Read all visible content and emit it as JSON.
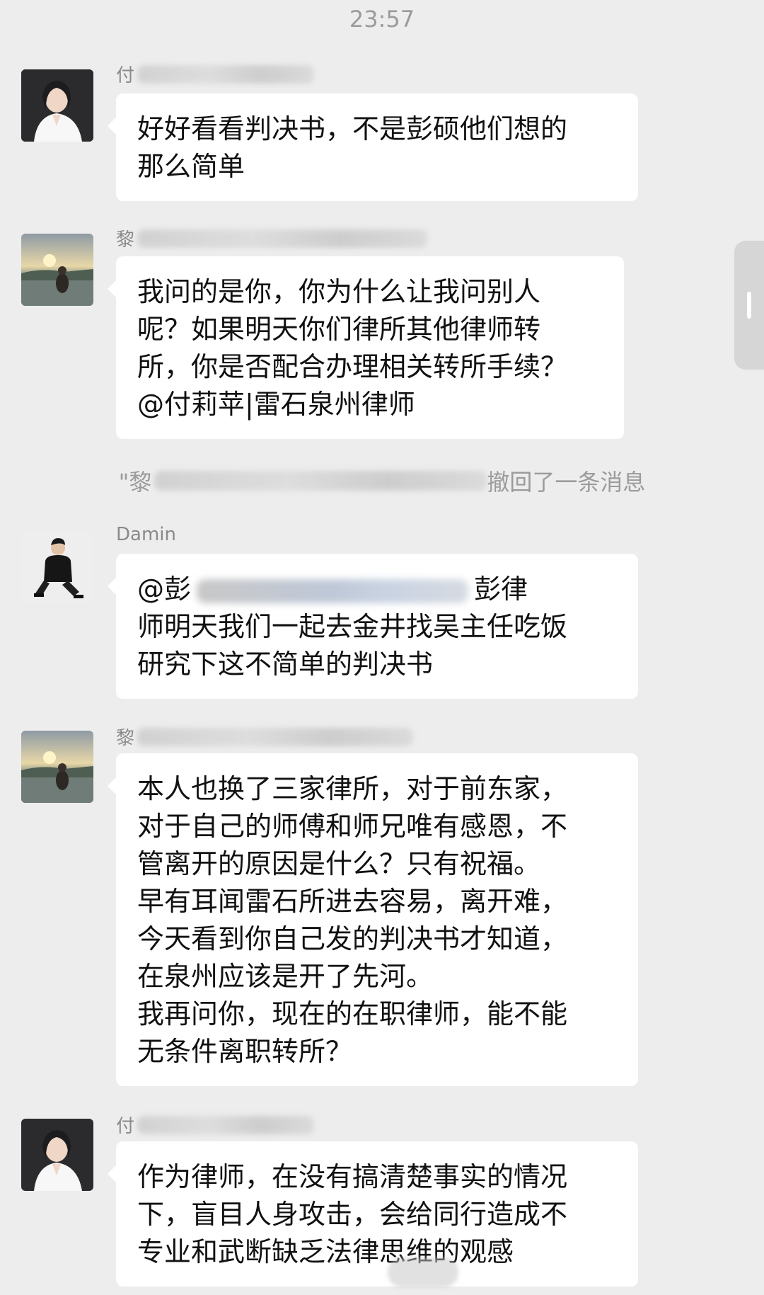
{
  "status": {
    "time": "23:57"
  },
  "messages": [
    {
      "sender_visible": "付",
      "lines": [
        "好好看看判决书，不是彭硕他们想的",
        "那么简单"
      ]
    },
    {
      "sender_visible": "黎",
      "lines": [
        "我问的是你，你为什么让我问别人",
        "呢？如果明天你们律所其他律师转",
        "所，你是否配合办理相关转所手续？",
        "@付莉苹|雷石泉州律师"
      ]
    },
    {
      "sender_visible": "Damin",
      "line1_start": "@彭",
      "line1_end": "彭律",
      "lines_rest": [
        "师明天我们一起去金井找吴主任吃饭",
        "研究下这不简单的判决书"
      ]
    },
    {
      "sender_visible": "黎",
      "lines": [
        "本人也换了三家律所，对于前东家，",
        "对于自己的师傅和师兄唯有感恩，不",
        "管离开的原因是什么？只有祝福。",
        "早有耳闻雷石所进去容易，离开难，",
        "今天看到你自己发的判决书才知道，",
        "在泉州应该是开了先河。",
        "我再问你，现在的在职律师，能不能",
        "无条件离职转所？"
      ]
    },
    {
      "sender_visible": "付",
      "lines": [
        "作为律师，在没有搞清楚事实的情况",
        "下，盲目人身攻击，会给同行造成不",
        "专业和武断缺乏法律思维的观感"
      ]
    }
  ],
  "recall_notice": {
    "prefix": "\"黎",
    "suffix": "撤回了一条消息"
  }
}
